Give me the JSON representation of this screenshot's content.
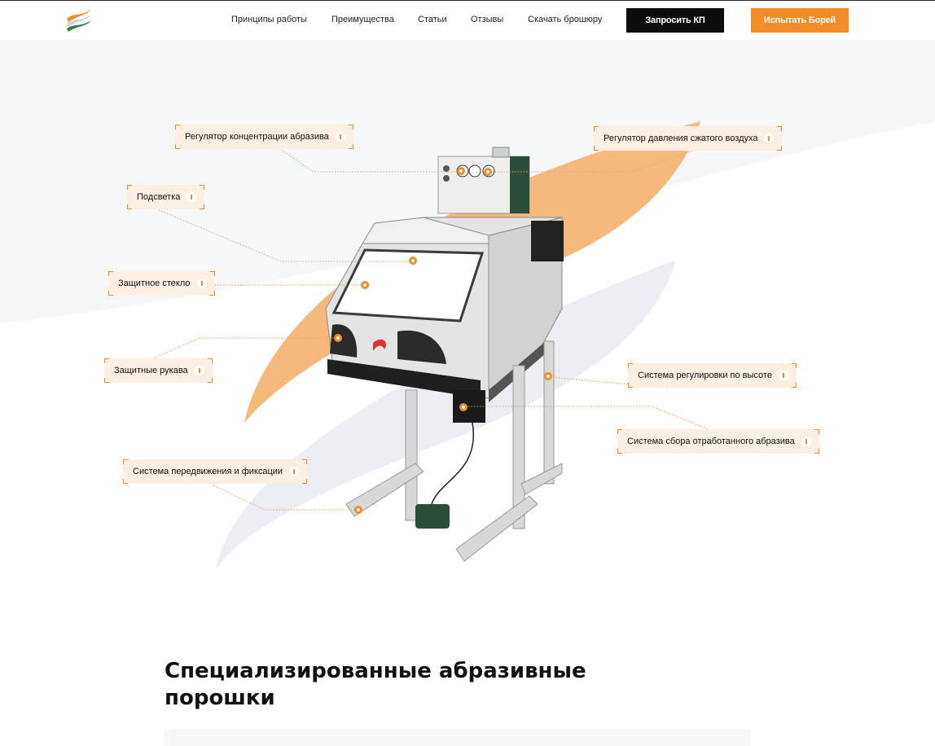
{
  "header": {
    "nav": [
      {
        "label": "Принципы работы"
      },
      {
        "label": "Преимущества"
      },
      {
        "label": "Статьи"
      },
      {
        "label": "Отзывы"
      },
      {
        "label": "Скачать брошюру"
      }
    ],
    "request_quote": "Запросить КП",
    "try_product": "Испытать Борей"
  },
  "hero": {
    "callouts": [
      {
        "id": "abrasive-concentration",
        "label": "Регулятор концентрации абразива"
      },
      {
        "id": "air-pressure",
        "label": "Регулятор давления сжатого воздуха"
      },
      {
        "id": "lighting",
        "label": "Подсветка"
      },
      {
        "id": "protective-glass",
        "label": "Защитное стекло"
      },
      {
        "id": "protective-sleeves",
        "label": "Защитные рукава"
      },
      {
        "id": "height-adjustment",
        "label": "Система регулировки по высоте"
      },
      {
        "id": "abrasive-collection",
        "label": "Система сбора отработанного абразива"
      },
      {
        "id": "movement-fixation",
        "label": "Система передвижения и фиксации"
      }
    ]
  },
  "section": {
    "title": "Специализированные абразивные порошки"
  },
  "colors": {
    "accent": "#f28c28",
    "dark_button": "#0d0d0d",
    "callout_bg": "#fbeee3",
    "wave_gray": "#eceef3"
  },
  "icons": [
    "logo-flag-icon",
    "info-icon",
    "hotspot-icon"
  ]
}
